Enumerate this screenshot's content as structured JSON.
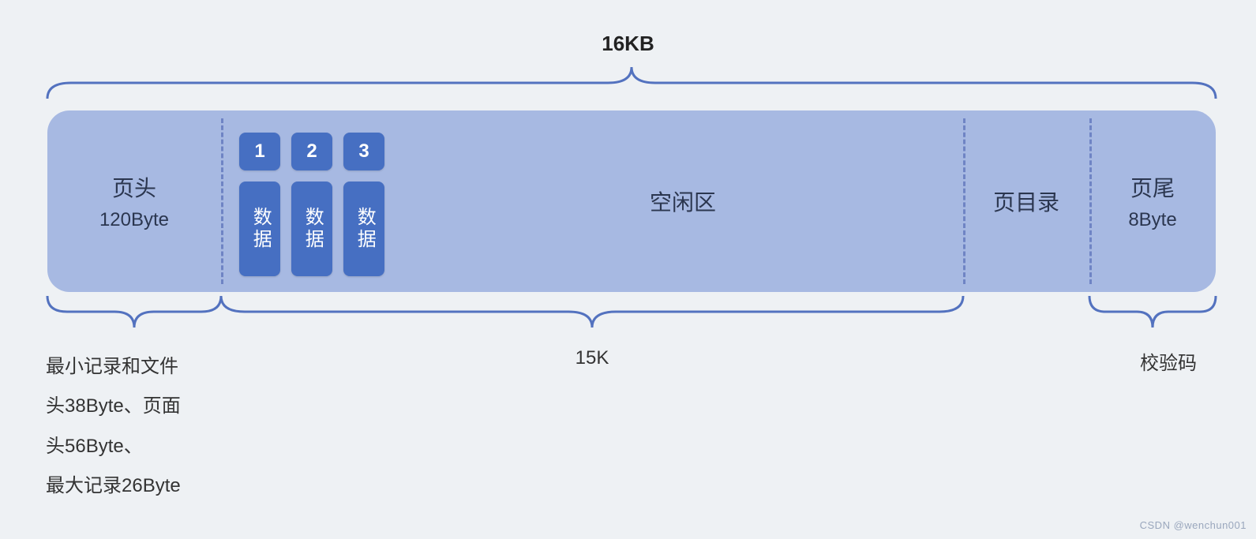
{
  "top": {
    "total_size": "16KB"
  },
  "segments": {
    "header": {
      "title": "页头",
      "size": "120Byte"
    },
    "data": {
      "numbers": [
        "1",
        "2",
        "3"
      ],
      "label": "数据"
    },
    "free": {
      "title": "空闲区"
    },
    "dir": {
      "title": "页目录"
    },
    "tail": {
      "title": "页尾",
      "size": "8Byte"
    }
  },
  "bottom": {
    "header_notes": [
      "最小记录和文件",
      "头38Byte、页面",
      "头56Byte、",
      "最大记录26Byte"
    ],
    "data_area_size": "15K",
    "tail_label": "校验码"
  },
  "watermark": "CSDN @wenchun001"
}
